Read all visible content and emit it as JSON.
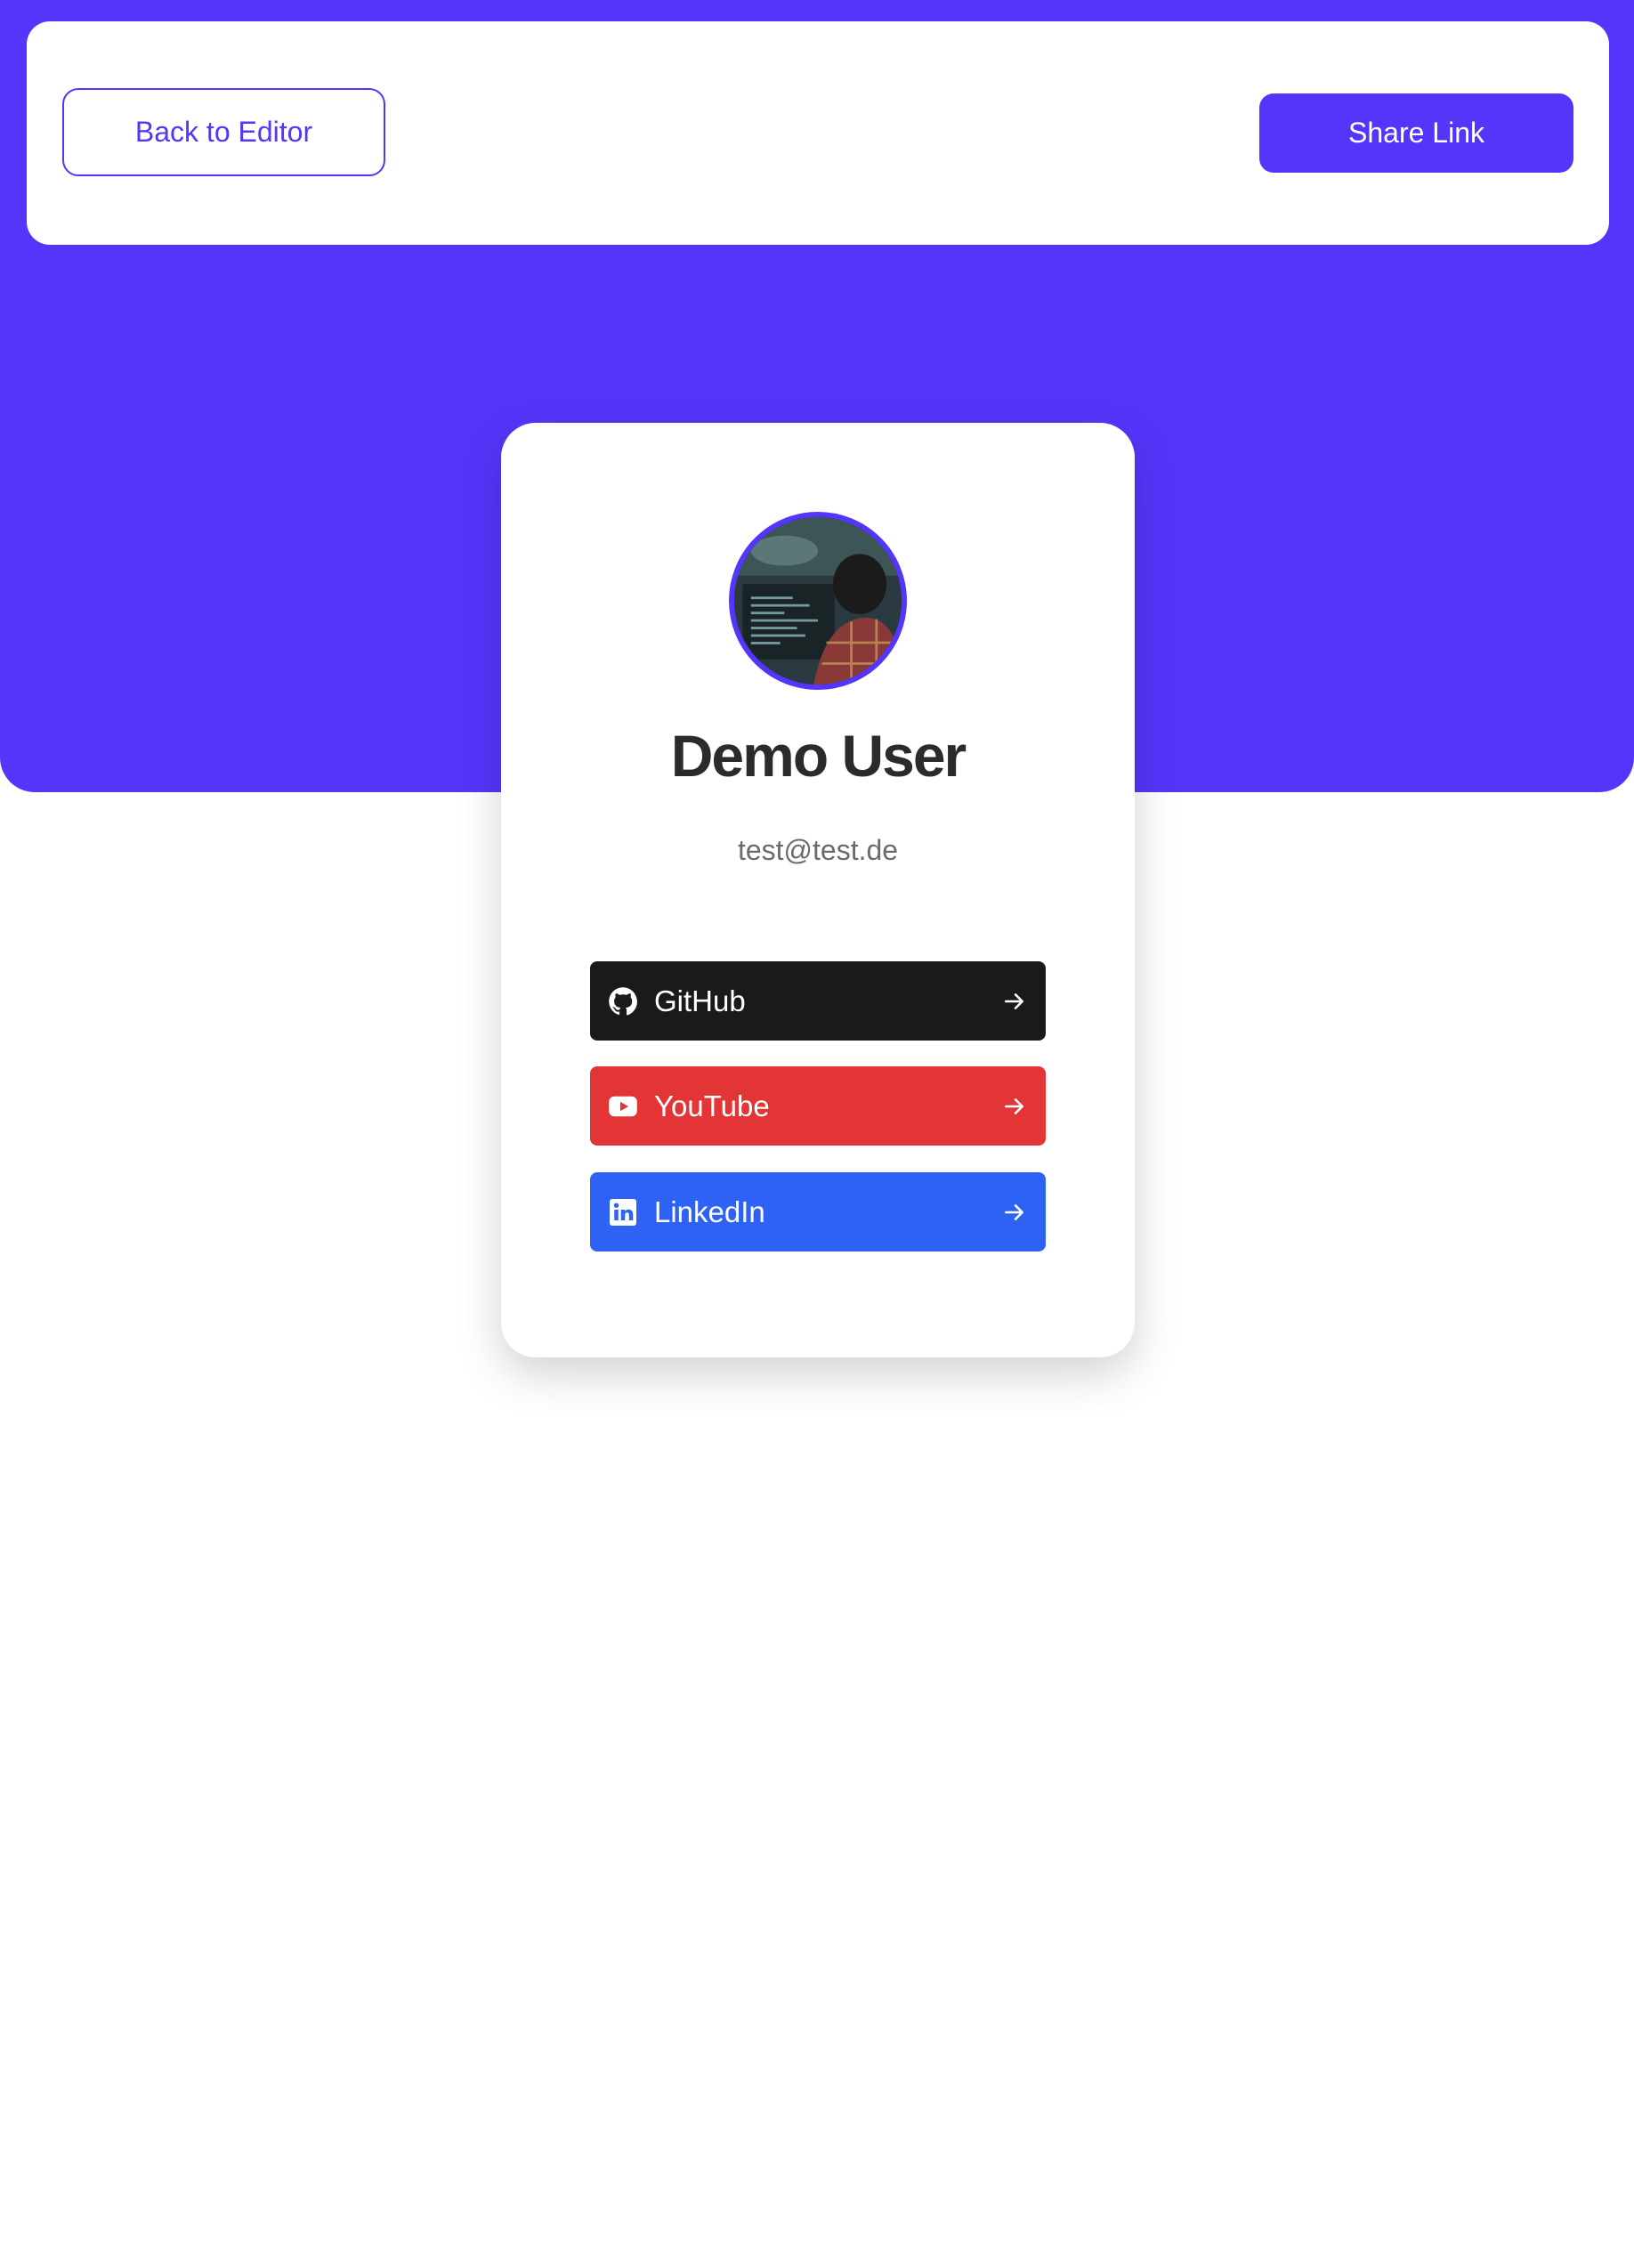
{
  "header": {
    "back_label": "Back to Editor",
    "share_label": "Share Link"
  },
  "profile": {
    "name": "Demo User",
    "email": "test@test.de",
    "avatar_alt": "profile photo"
  },
  "links": [
    {
      "platform": "GitHub",
      "color": "#1a1a1a",
      "icon": "github-icon"
    },
    {
      "platform": "YouTube",
      "color": "#e43536",
      "icon": "youtube-icon"
    },
    {
      "platform": "LinkedIn",
      "color": "#2e62f5",
      "icon": "linkedin-icon"
    }
  ],
  "colors": {
    "accent": "#5436fb",
    "background": "#ffffff",
    "text_dark": "#2b2b2b",
    "text_muted": "#6b6b6b"
  }
}
